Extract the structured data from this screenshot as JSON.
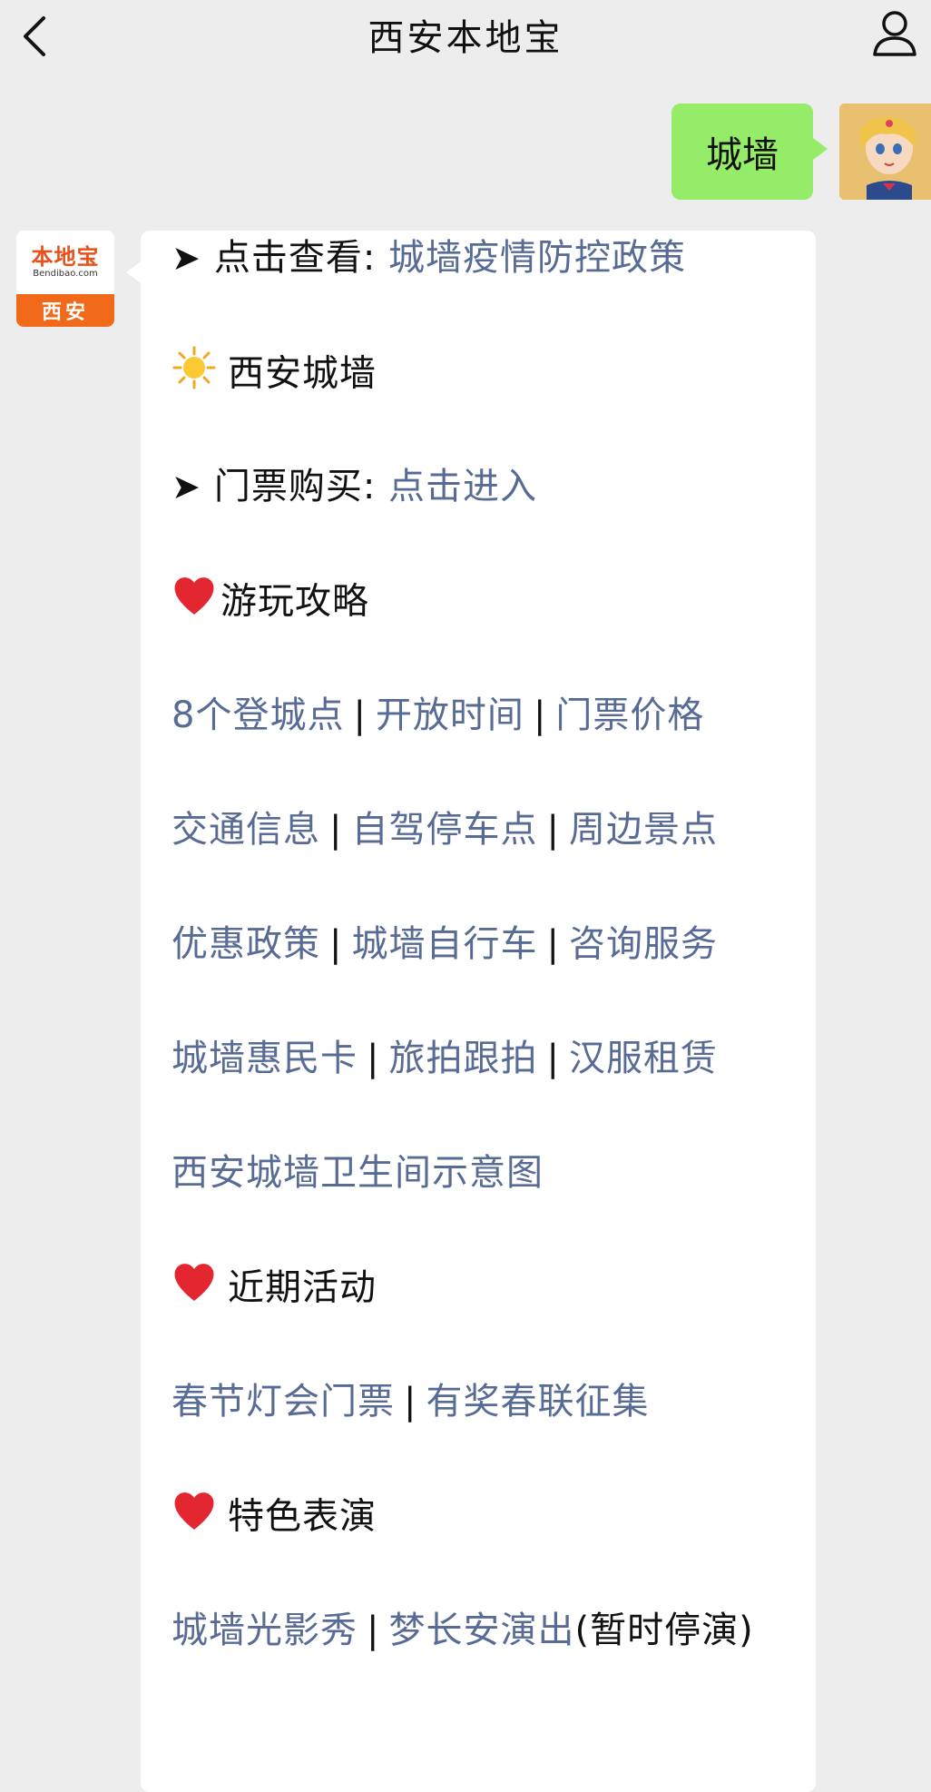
{
  "header": {
    "title": "西安本地宝"
  },
  "outgoing": {
    "text": "城墙"
  },
  "bot_avatar": {
    "logo_cn": "本地宝",
    "logo_en": "Bendibao.com",
    "city": "西安"
  },
  "message": {
    "line1": {
      "prefix": "点击查看: ",
      "link": "城墙疫情防控政策"
    },
    "line2": {
      "text": "西安城墙"
    },
    "line3": {
      "prefix": "门票购买: ",
      "link": "点击进入"
    },
    "line4": {
      "text": "游玩攻略"
    },
    "line5": {
      "links": [
        "8个登城点",
        "开放时间",
        "门票价格"
      ]
    },
    "line6": {
      "links": [
        "交通信息",
        "自驾停车点",
        "周边景点"
      ]
    },
    "line7": {
      "links": [
        "优惠政策",
        "城墙自行车",
        "咨询服务"
      ]
    },
    "line8": {
      "links": [
        "城墙惠民卡",
        "旅拍跟拍",
        "汉服租赁"
      ]
    },
    "line9": {
      "link": "西安城墙卫生间示意图"
    },
    "line10": {
      "text": "近期活动"
    },
    "line11": {
      "links": [
        "春节灯会门票",
        "有奖春联征集"
      ]
    },
    "line12": {
      "text": "特色表演"
    },
    "line13": {
      "links": [
        "城墙光影秀",
        "梦长安演出"
      ],
      "suffix": "(暂时停演)"
    },
    "separator": "|"
  },
  "colors": {
    "link": "#576b95",
    "outgoing_bubble": "#95ec69",
    "background": "#ededed"
  }
}
